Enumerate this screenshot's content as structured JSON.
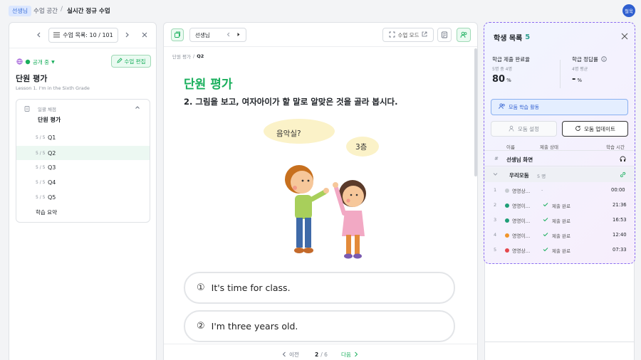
{
  "topbar": {
    "role": "선생님",
    "crumb1": "수업 공간",
    "sep": "/",
    "crumb2": "실시간 정규 수업",
    "avatar": "철욱"
  },
  "left": {
    "toc_label": "수업 목록: 10 / 101",
    "visibility": "공개 중",
    "edit_label": "수업 편집",
    "title": "단원 평가",
    "subtitle": "Lesson 1. I'm in the Sixth Grade",
    "group_tag": "일괄 채점",
    "group_title": "단원 평가",
    "items": [
      {
        "score": "5 / 5",
        "label": "Q1"
      },
      {
        "score": "5 / 5",
        "label": "Q2"
      },
      {
        "score": "5 / 5",
        "label": "Q3"
      },
      {
        "score": "5 / 5",
        "label": "Q4"
      },
      {
        "score": "5 / 5",
        "label": "Q5"
      }
    ],
    "summary": "학습 요약"
  },
  "center": {
    "teacher_select": "선생님",
    "lesson_mode": "수업 모드",
    "breadcrumb_a": "단원 평가",
    "breadcrumb_sep": "/",
    "breadcrumb_b": "Q2",
    "heading": "단원 평가",
    "question": "2. 그림을 보고, 여자아이가 할 말로 알맞은 것을 골라 봅시다.",
    "bubble1": "음악실?",
    "bubble2": "3층",
    "options": [
      {
        "num": "①",
        "text": "It's time for class."
      },
      {
        "num": "②",
        "text": "I'm three years old."
      }
    ],
    "prev": "이전",
    "page_current": "2",
    "page_total": "/ 6",
    "next": "다음"
  },
  "right": {
    "title": "학생 목록",
    "count": "5",
    "stat1_label": "학급 제출 완료율",
    "stat1_sub": "5명 중 4명",
    "stat1_value": "80",
    "stat1_unit": "%",
    "stat2_label": "학급 정답률",
    "stat2_sub": "4명 평균",
    "stat2_value": "-",
    "stat2_unit": "%",
    "group_activity": "모둠 학습 활동",
    "group_setting": "모둠 설정",
    "group_update": "모둠 업데이트",
    "col_name": "이름",
    "col_status": "제출 상태",
    "col_time": "학습 시간",
    "teacher_row_num": "#",
    "teacher_row": "선생님 화면",
    "group_name": "우리모둠",
    "group_count": "5 명",
    "students": [
      {
        "num": "1",
        "name": "영영상...",
        "status": "-",
        "time": "00:00",
        "color": "#c8ccd2",
        "checked": false
      },
      {
        "num": "2",
        "name": "영영이...",
        "status": "제출 완료",
        "time": "21:36",
        "color": "#1f9e77",
        "checked": true
      },
      {
        "num": "3",
        "name": "영영이...",
        "status": "제출 완료",
        "time": "16:53",
        "color": "#1f9e77",
        "checked": true
      },
      {
        "num": "4",
        "name": "영영이...",
        "status": "제출 완료",
        "time": "12:40",
        "color": "#f0952b",
        "checked": true
      },
      {
        "num": "5",
        "name": "영영상...",
        "status": "제출 완료",
        "time": "07:33",
        "color": "#e5484d",
        "checked": true
      }
    ]
  },
  "colors": {
    "accent_green": "#1aaf5d",
    "brand_blue": "#2f5fd0",
    "purple_border": "#8b6cf0"
  }
}
